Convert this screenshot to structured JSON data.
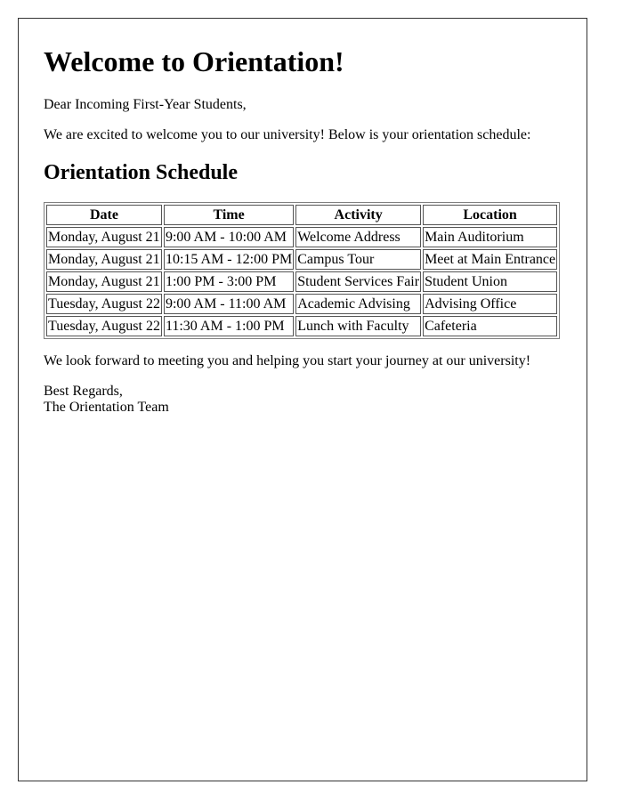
{
  "letter": {
    "title": "Welcome to Orientation!",
    "greeting": "Dear Incoming First-Year Students,",
    "intro": "We are excited to welcome you to our university! Below is your orientation schedule:",
    "schedule_heading": "Orientation Schedule",
    "table": {
      "headers": [
        "Date",
        "Time",
        "Activity",
        "Location"
      ],
      "rows": [
        [
          "Monday, August 21",
          "9:00 AM - 10:00 AM",
          "Welcome Address",
          "Main Auditorium"
        ],
        [
          "Monday, August 21",
          "10:15 AM - 12:00 PM",
          "Campus Tour",
          "Meet at Main Entrance"
        ],
        [
          "Monday, August 21",
          "1:00 PM - 3:00 PM",
          "Student Services Fair",
          "Student Union"
        ],
        [
          "Tuesday, August 22",
          "9:00 AM - 11:00 AM",
          "Academic Advising",
          "Advising Office"
        ],
        [
          "Tuesday, August 22",
          "11:30 AM - 1:00 PM",
          "Lunch with Faculty",
          "Cafeteria"
        ]
      ]
    },
    "outro": "We look forward to meeting you and helping you start your journey at our university!",
    "signoff": "Best Regards,",
    "signature": "The Orientation Team"
  }
}
